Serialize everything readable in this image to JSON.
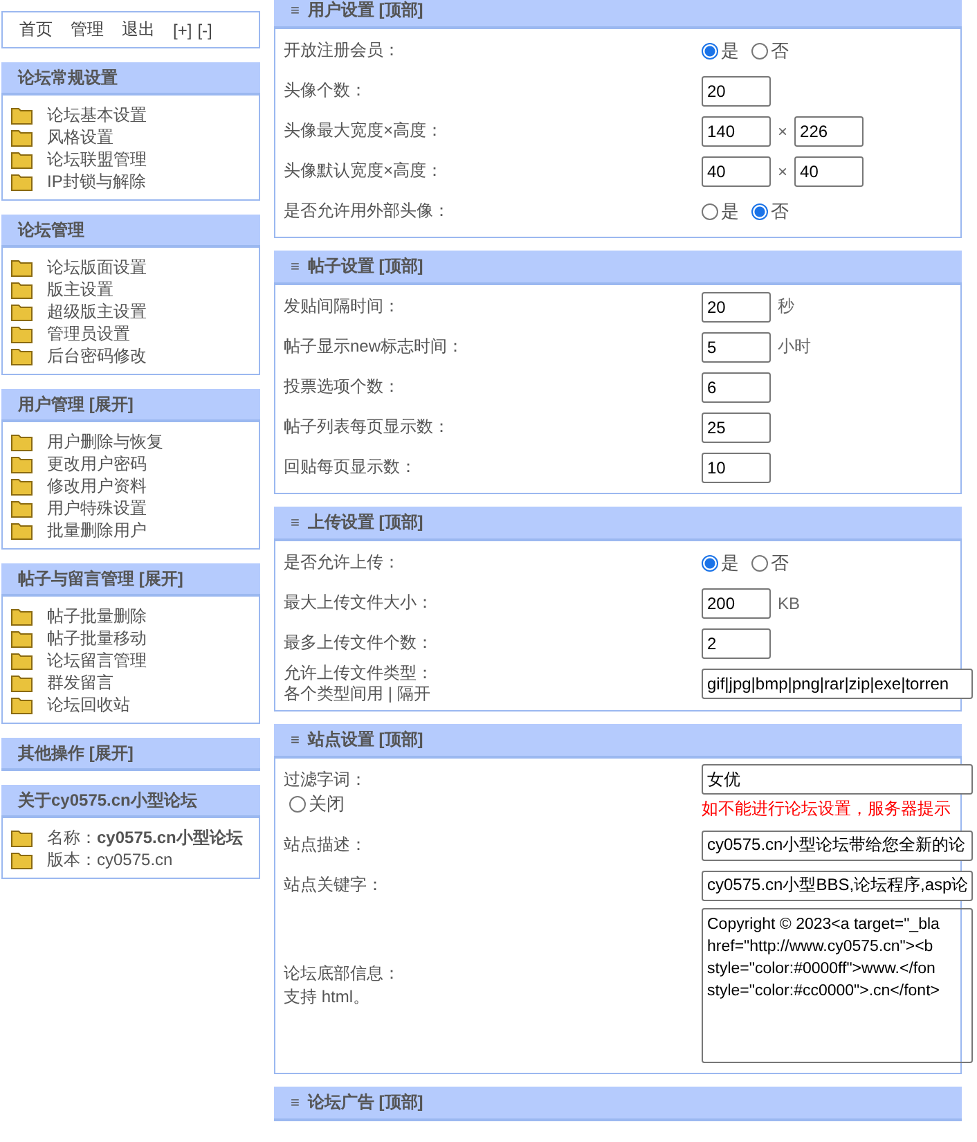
{
  "top_nav": {
    "links": [
      "首页",
      "管理",
      "退出",
      "[+]",
      "[-]"
    ]
  },
  "sidebar": {
    "sections": [
      {
        "title": "论坛常规设置",
        "items": [
          "论坛基本设置",
          "风格设置",
          "论坛联盟管理",
          "IP封锁与解除"
        ]
      },
      {
        "title": "论坛管理",
        "items": [
          "论坛版面设置",
          "版主设置",
          "超级版主设置",
          "管理员设置",
          "后台密码修改"
        ]
      },
      {
        "title": "用户管理 [展开]",
        "items": [
          "用户删除与恢复",
          "更改用户密码",
          "修改用户资料",
          "用户特殊设置",
          "批量删除用户"
        ]
      },
      {
        "title": "帖子与留言管理 [展开]",
        "items": [
          "帖子批量删除",
          "帖子批量移动",
          "论坛留言管理",
          "群发留言",
          "论坛回收站"
        ]
      },
      {
        "title": "其他操作 [展开]"
      },
      {
        "title": "关于cy0575.cn小型论坛",
        "items": [
          "名称：**cy0575.cn小型论坛**",
          "版本：cy0575.cn"
        ]
      }
    ]
  },
  "sections": [
    {
      "glyph": "≡",
      "title": "用户设置 [顶部]",
      "rows": [
        {
          "kind": "radio",
          "label": "开放注册会员：",
          "options": [
            {
              "label": "是",
              "selected": true
            },
            {
              "label": "否",
              "selected": false
            }
          ]
        },
        {
          "kind": "inputs",
          "label": "头像个数：",
          "values": [
            "20"
          ]
        },
        {
          "kind": "inputs",
          "label": "头像最大宽度×高度：",
          "values": [
            "140",
            "226"
          ],
          "separator": "×"
        },
        {
          "kind": "inputs",
          "label": "头像默认宽度×高度：",
          "values": [
            "40",
            "40"
          ],
          "separator": "×"
        },
        {
          "kind": "radio",
          "label": "是否允许用外部头像：",
          "options": [
            {
              "label": "是",
              "selected": false
            },
            {
              "label": "否",
              "selected": true
            }
          ]
        }
      ]
    },
    {
      "glyph": "≡",
      "title": "帖子设置 [顶部]",
      "rows": [
        {
          "kind": "inputs",
          "label": "发贴间隔时间：",
          "values": [
            "20"
          ],
          "unit": "秒"
        },
        {
          "kind": "inputs",
          "label": "帖子显示new标志时间：",
          "values": [
            "5"
          ],
          "unit": "小时"
        },
        {
          "kind": "inputs",
          "label": "投票选项个数：",
          "values": [
            "6"
          ]
        },
        {
          "kind": "inputs",
          "label": "帖子列表每页显示数：",
          "values": [
            "25"
          ]
        },
        {
          "kind": "inputs",
          "label": "回贴每页显示数：",
          "values": [
            "10"
          ]
        }
      ]
    },
    {
      "glyph": "≡",
      "title": "上传设置 [顶部]",
      "rows": [
        {
          "kind": "radio",
          "label": "是否允许上传：",
          "options": [
            {
              "label": "是",
              "selected": true
            },
            {
              "label": "否",
              "selected": false
            }
          ]
        },
        {
          "kind": "inputs",
          "label": "最大上传文件大小：",
          "values": [
            "200"
          ],
          "unit": "KB"
        },
        {
          "kind": "inputs",
          "label": "最多上传文件个数：",
          "values": [
            "2"
          ]
        },
        {
          "kind": "wide",
          "label": "允许上传文件类型：",
          "note": "各个类型间用 | 隔开",
          "value": "gif|jpg|bmp|png|rar|zip|exe|torren"
        }
      ]
    },
    {
      "glyph": "≡",
      "title": "站点设置 [顶部]",
      "rows": [
        {
          "kind": "filter",
          "label": "过滤字词：",
          "option": {
            "label": "关闭",
            "selected": false
          },
          "value": "女优",
          "warning": "如不能进行论坛设置，服务器提示"
        },
        {
          "kind": "wide",
          "label": "站点描述：",
          "value": "cy0575.cn小型论坛带给您全新的论"
        },
        {
          "kind": "wide",
          "label": "站点关键字：",
          "value": "cy0575.cn小型BBS,论坛程序,asp论"
        },
        {
          "kind": "textarea",
          "label": "论坛底部信息：",
          "note": "支持 html。",
          "lines": [
            "Copyright © 2023<a target=\"_bla",
            "href=\"http://www.cy0575.cn\"><b",
            "style=\"color:#0000ff\">www.</fon",
            "style=\"color:#cc0000\">.cn</font>"
          ]
        }
      ]
    },
    {
      "glyph": "≡",
      "title": "论坛广告 [顶部]"
    }
  ]
}
